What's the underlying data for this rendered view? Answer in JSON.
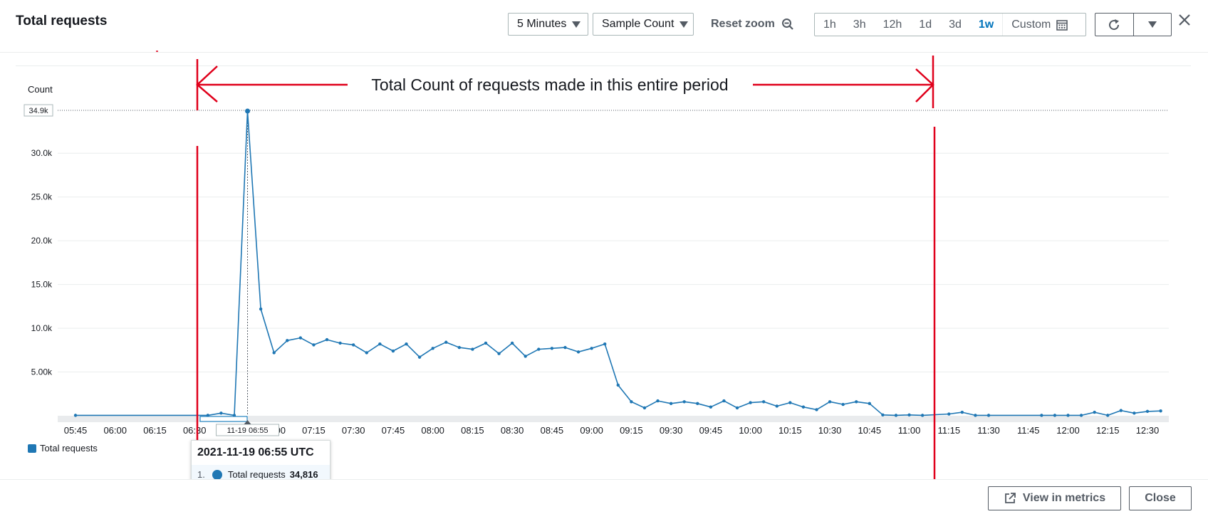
{
  "header": {
    "title": "Total requests",
    "period_label": "5 Minutes",
    "statistic_label": "Sample Count",
    "reset_zoom_label": "Reset zoom",
    "ranges": [
      "1h",
      "3h",
      "12h",
      "1d",
      "3d",
      "1w"
    ],
    "active_range": "1w",
    "custom_label": "Custom"
  },
  "footer": {
    "view_in_metrics_label": "View in metrics",
    "close_label": "Close"
  },
  "annotation": {
    "text": "Total Count of requests made in this entire period",
    "color": "#e0001b"
  },
  "tooltip": {
    "date": "2021-11-19 06:55 UTC",
    "index": "1.",
    "series": "Total requests",
    "value": "34,816"
  },
  "chart_data": {
    "type": "line",
    "ylabel": "Count",
    "ylim": [
      0,
      34900
    ],
    "yticks": [
      5000,
      10000,
      15000,
      20000,
      25000,
      30000
    ],
    "ytick_labels": [
      "5.00k",
      "10.0k",
      "15.0k",
      "20.0k",
      "25.0k",
      "30.0k"
    ],
    "max_label": "34.9k",
    "x_start": "05:45",
    "x_end": "12:35",
    "xtick_labels": [
      "05:45",
      "06:00",
      "06:15",
      "06:30",
      "06:45",
      "07:00",
      "07:15",
      "07:30",
      "07:45",
      "08:00",
      "08:15",
      "08:30",
      "08:45",
      "09:00",
      "09:15",
      "09:30",
      "09:45",
      "10:00",
      "10:15",
      "10:30",
      "10:45",
      "11:00",
      "11:15",
      "11:30",
      "11:45",
      "12:00",
      "12:15",
      "12:30"
    ],
    "hover_label": "11-19 06:55",
    "legend": [
      "Total requests"
    ],
    "color": "#1f77b4",
    "series": [
      {
        "name": "Total requests",
        "points": [
          [
            "05:45",
            50
          ],
          [
            "06:35",
            50
          ],
          [
            "06:40",
            300
          ],
          [
            "06:45",
            50
          ],
          [
            "06:50",
            34816
          ],
          [
            "06:55",
            12200
          ],
          [
            "07:00",
            7200
          ],
          [
            "07:05",
            8600
          ],
          [
            "07:10",
            8900
          ],
          [
            "07:15",
            8100
          ],
          [
            "07:20",
            8700
          ],
          [
            "07:25",
            8300
          ],
          [
            "07:30",
            8100
          ],
          [
            "07:35",
            7200
          ],
          [
            "07:40",
            8200
          ],
          [
            "07:45",
            7400
          ],
          [
            "07:50",
            8200
          ],
          [
            "07:55",
            6700
          ],
          [
            "08:00",
            7700
          ],
          [
            "08:05",
            8400
          ],
          [
            "08:10",
            7800
          ],
          [
            "08:15",
            7600
          ],
          [
            "08:20",
            8300
          ],
          [
            "08:25",
            7100
          ],
          [
            "08:30",
            8300
          ],
          [
            "08:35",
            6800
          ],
          [
            "08:40",
            7600
          ],
          [
            "08:45",
            7700
          ],
          [
            "08:50",
            7800
          ],
          [
            "08:55",
            7300
          ],
          [
            "09:00",
            7700
          ],
          [
            "09:05",
            8200
          ],
          [
            "09:10",
            3500
          ],
          [
            "09:15",
            1600
          ],
          [
            "09:20",
            900
          ],
          [
            "09:25",
            1700
          ],
          [
            "09:30",
            1400
          ],
          [
            "09:35",
            1600
          ],
          [
            "09:40",
            1400
          ],
          [
            "09:45",
            1000
          ],
          [
            "09:50",
            1700
          ],
          [
            "09:55",
            900
          ],
          [
            "10:00",
            1500
          ],
          [
            "10:05",
            1600
          ],
          [
            "10:10",
            1100
          ],
          [
            "10:15",
            1500
          ],
          [
            "10:20",
            1000
          ],
          [
            "10:25",
            700
          ],
          [
            "10:30",
            1600
          ],
          [
            "10:35",
            1300
          ],
          [
            "10:40",
            1600
          ],
          [
            "10:45",
            1400
          ],
          [
            "10:50",
            100
          ],
          [
            "10:55",
            50
          ],
          [
            "11:00",
            100
          ],
          [
            "11:05",
            50
          ],
          [
            "11:15",
            200
          ],
          [
            "11:20",
            400
          ],
          [
            "11:25",
            50
          ],
          [
            "11:30",
            50
          ],
          [
            "11:50",
            50
          ],
          [
            "11:55",
            50
          ],
          [
            "12:00",
            50
          ],
          [
            "12:05",
            50
          ],
          [
            "12:10",
            400
          ],
          [
            "12:15",
            50
          ],
          [
            "12:20",
            600
          ],
          [
            "12:25",
            300
          ],
          [
            "12:30",
            500
          ],
          [
            "12:35",
            550
          ]
        ]
      }
    ]
  }
}
